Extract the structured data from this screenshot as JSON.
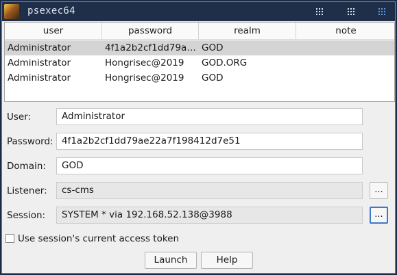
{
  "window": {
    "title": "psexec64",
    "icons": [
      "app-avatar-icon",
      "layout-grid-icon",
      "layout-grid-dense-icon",
      "layout-grid-active-icon"
    ]
  },
  "table": {
    "columns": [
      "user",
      "password",
      "realm",
      "note"
    ],
    "rows": [
      {
        "user": "Administrator",
        "password": "4f1a2b2cf1dd79ae2...",
        "realm": "GOD",
        "note": "",
        "selected": true
      },
      {
        "user": "Administrator",
        "password": "Hongrisec@2019",
        "realm": "GOD.ORG",
        "note": "",
        "selected": false
      },
      {
        "user": "Administrator",
        "password": "Hongrisec@2019",
        "realm": "GOD",
        "note": "",
        "selected": false
      }
    ]
  },
  "form": {
    "user_label": "User:",
    "user_value": "Administrator",
    "password_label": "Password:",
    "password_value": "4f1a2b2cf1dd79ae22a7f198412d7e51",
    "domain_label": "Domain:",
    "domain_value": "GOD",
    "listener_label": "Listener:",
    "listener_value": "cs-cms",
    "listener_button": "...",
    "session_label": "Session:",
    "session_value": "SYSTEM * via  192.168.52.138@3988",
    "session_button": "...",
    "token_checkbox_label": "Use session's current access token",
    "token_checkbox_checked": false
  },
  "actions": {
    "launch_label": "Launch",
    "help_label": "Help"
  },
  "colors": {
    "titlebar": "#1f2f4a",
    "selected_row": "#d4d4d4",
    "focus_accent": "#3d78c9"
  }
}
